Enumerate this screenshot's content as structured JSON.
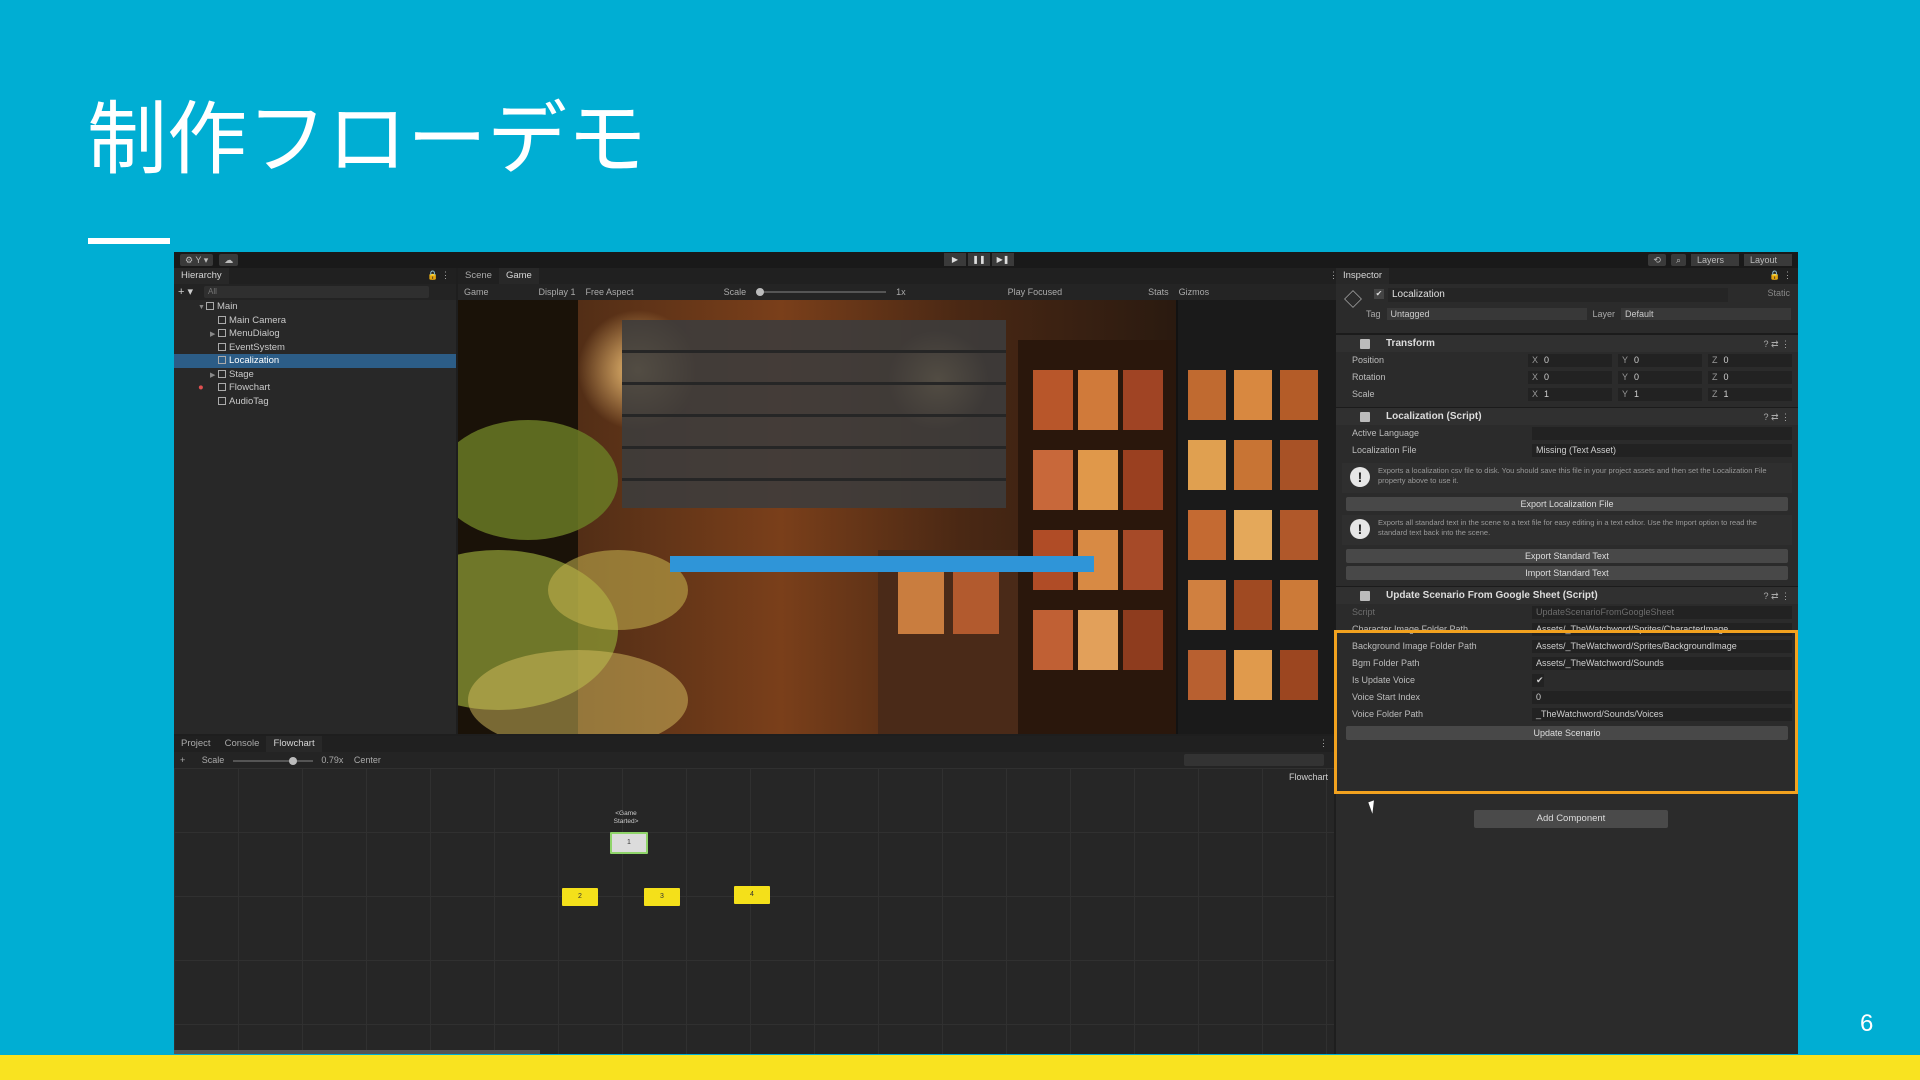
{
  "slide": {
    "title": "制作フローデモ",
    "page_number": "6"
  },
  "colors": {
    "background": "#00AED3",
    "bottom_band": "#F9E320",
    "highlight": "#F2A21F",
    "selection": "#2c5d87",
    "dialog_bar": "#2f95d8"
  },
  "toolbar": {
    "account": "⚙ Y ▾",
    "cloud_icon": "cloud-icon",
    "play": "▶",
    "pause": "❚❚",
    "step": "▶❚",
    "history_icon": "history-icon",
    "search_icon": "search-icon",
    "layers": "Layers",
    "layout": "Layout"
  },
  "hierarchy": {
    "tab": "Hierarchy",
    "search_placeholder": "All",
    "items": [
      {
        "label": "Main"
      },
      {
        "label": "Main Camera"
      },
      {
        "label": "MenuDialog"
      },
      {
        "label": "EventSystem"
      },
      {
        "label": "Localization"
      },
      {
        "label": "Stage"
      },
      {
        "label": "Flowchart"
      },
      {
        "label": "AudioTag"
      }
    ]
  },
  "game": {
    "tabs": [
      "Scene",
      "Game"
    ],
    "display_mode": "Game",
    "display": "Display 1",
    "aspect": "Free Aspect",
    "scale_label": "Scale",
    "scale_value": "1x",
    "play_mode": "Play Focused",
    "stats": "Stats",
    "gizmos": "Gizmos"
  },
  "inspector": {
    "tab": "Inspector",
    "object_name": "Localization",
    "static_label": "Static",
    "tag_label": "Tag",
    "tag_value": "Untagged",
    "layer_label": "Layer",
    "layer_value": "Default",
    "transform": {
      "title": "Transform",
      "position_label": "Position",
      "rotation_label": "Rotation",
      "scale_label": "Scale",
      "position": {
        "x": "0",
        "y": "0",
        "z": "0"
      },
      "rotation": {
        "x": "0",
        "y": "0",
        "z": "0"
      },
      "scale": {
        "x": "1",
        "y": "1",
        "z": "1"
      }
    },
    "localization": {
      "title": "Localization (Script)",
      "active_language_label": "Active Language",
      "active_language_value": "",
      "localization_file_label": "Localization File",
      "localization_file_value": "Missing (Text Asset)",
      "help1": "Exports a localization csv file to disk. You should save this file in your project assets and then set the Localization File property above to use it.",
      "export_localization_button": "Export Localization File",
      "help2": "Exports all standard text in the scene to a text file for easy editing in a text editor. Use the Import option to read the standard text back into the scene.",
      "export_standard_button": "Export Standard Text",
      "import_standard_button": "Import Standard Text"
    },
    "update_scenario": {
      "title": "Update Scenario From Google Sheet (Script)",
      "script_label": "Script",
      "script_value": "UpdateScenarioFromGoogleSheet",
      "char_image_label": "Character Image Folder Path",
      "char_image_value": "Assets/_TheWatchword/Sprites/CharacterImage",
      "bg_image_label": "Background Image Folder Path",
      "bg_image_value": "Assets/_TheWatchword/Sprites/BackgroundImage",
      "bgm_label": "Bgm Folder Path",
      "bgm_value": "Assets/_TheWatchword/Sounds",
      "update_voice_label": "Is Update Voice",
      "update_voice_value": "✔",
      "voice_start_label": "Voice Start Index",
      "voice_start_value": "0",
      "voice_folder_label": "Voice Folder Path",
      "voice_folder_value": "_TheWatchword/Sounds/Voices",
      "update_button": "Update Scenario"
    },
    "add_component_button": "Add Component"
  },
  "flowchart": {
    "tabs": [
      "Project",
      "Console",
      "Flowchart"
    ],
    "scale_label": "Scale",
    "scale_value": "0.79x",
    "center_button": "Center",
    "canvas_label": "Flowchart",
    "event_label": "<Game Started>",
    "nodes": [
      {
        "label": "1"
      },
      {
        "label": "2"
      },
      {
        "label": "3"
      },
      {
        "label": "4"
      }
    ]
  }
}
